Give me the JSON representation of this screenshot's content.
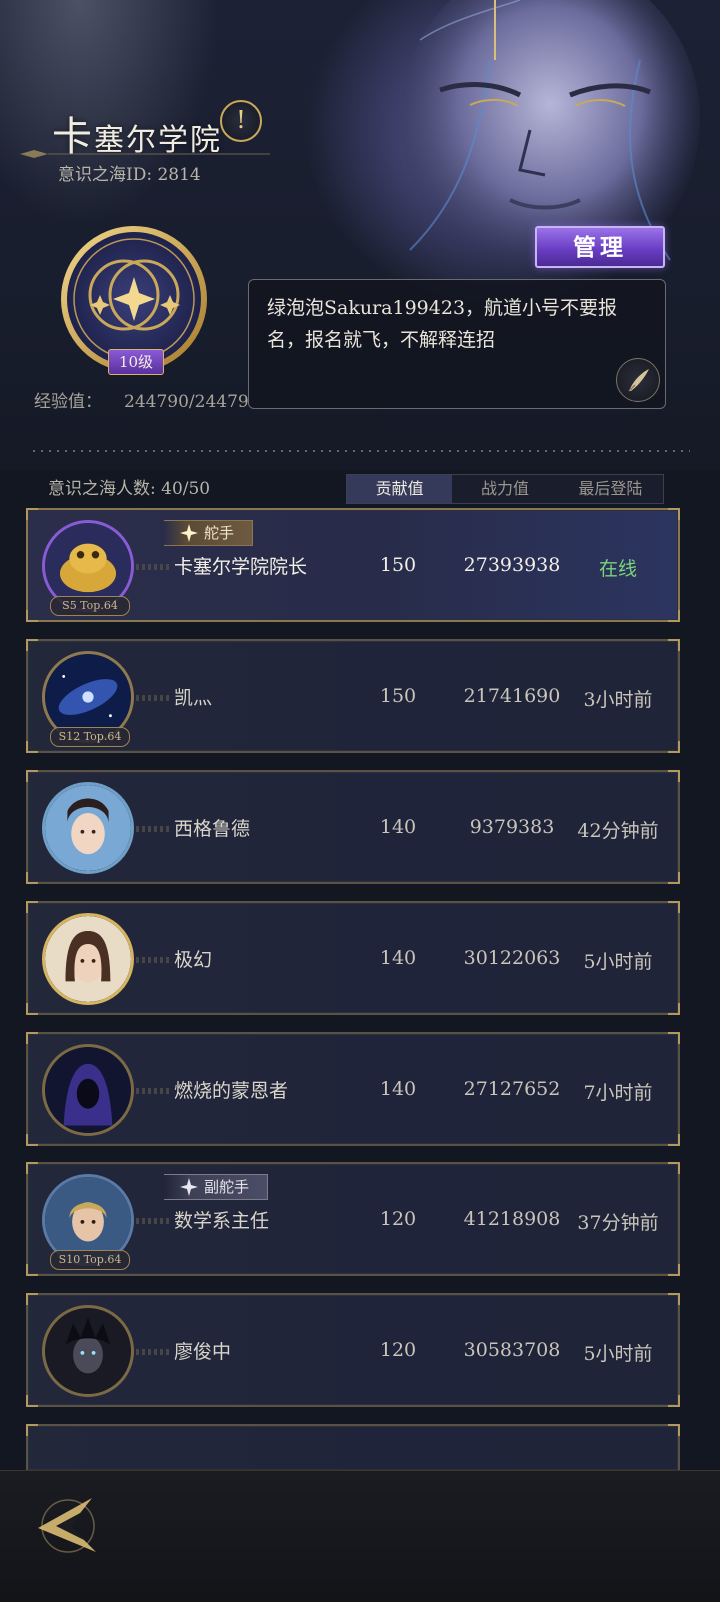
{
  "header": {
    "academy_name": "卡塞尔学院",
    "academy_name_first": "卡",
    "academy_name_rest": "塞尔学院",
    "sea_id": "意识之海ID: 2814",
    "notice_icon": "exclamation-icon"
  },
  "profile": {
    "level": "10级",
    "exp_label": "经验值：",
    "exp_value": "244790/24479"
  },
  "manage_button": "管理",
  "notice_text": "绿泡泡Sakura199423，航道小号不要报名，报名就飞，不解释连招",
  "members": {
    "count_label": "意识之海人数: 40/50",
    "tabs": [
      "贡献值",
      "战力值",
      "最后登陆"
    ],
    "active_tab": 0,
    "rows": [
      {
        "name": "卡塞尔学院院长",
        "contribution": "150",
        "power": "27393938",
        "last_login": "在线",
        "role": "舵手",
        "season": "S5 Top.64"
      },
      {
        "name": "凯灬",
        "contribution": "150",
        "power": "21741690",
        "last_login": "3小时前",
        "role": "",
        "season": "S12 Top.64"
      },
      {
        "name": "西格鲁德",
        "contribution": "140",
        "power": "9379383",
        "last_login": "42分钟前",
        "role": "",
        "season": ""
      },
      {
        "name": "极幻",
        "contribution": "140",
        "power": "30122063",
        "last_login": "5小时前",
        "role": "",
        "season": ""
      },
      {
        "name": "燃烧的蒙恩者",
        "contribution": "140",
        "power": "27127652",
        "last_login": "7小时前",
        "role": "",
        "season": ""
      },
      {
        "name": "数学系主任",
        "contribution": "120",
        "power": "41218908",
        "last_login": "37分钟前",
        "role": "副舵手",
        "season": "S10 Top.64"
      },
      {
        "name": "廖俊中",
        "contribution": "120",
        "power": "30583708",
        "last_login": "5小时前",
        "role": "",
        "season": ""
      }
    ]
  },
  "colors": {
    "online": "#7ad57a",
    "accent_gold": "#c9a85a",
    "manage_purple": "#6a3fc4"
  },
  "bottom": {
    "back_icon": "back-arrow-icon"
  }
}
